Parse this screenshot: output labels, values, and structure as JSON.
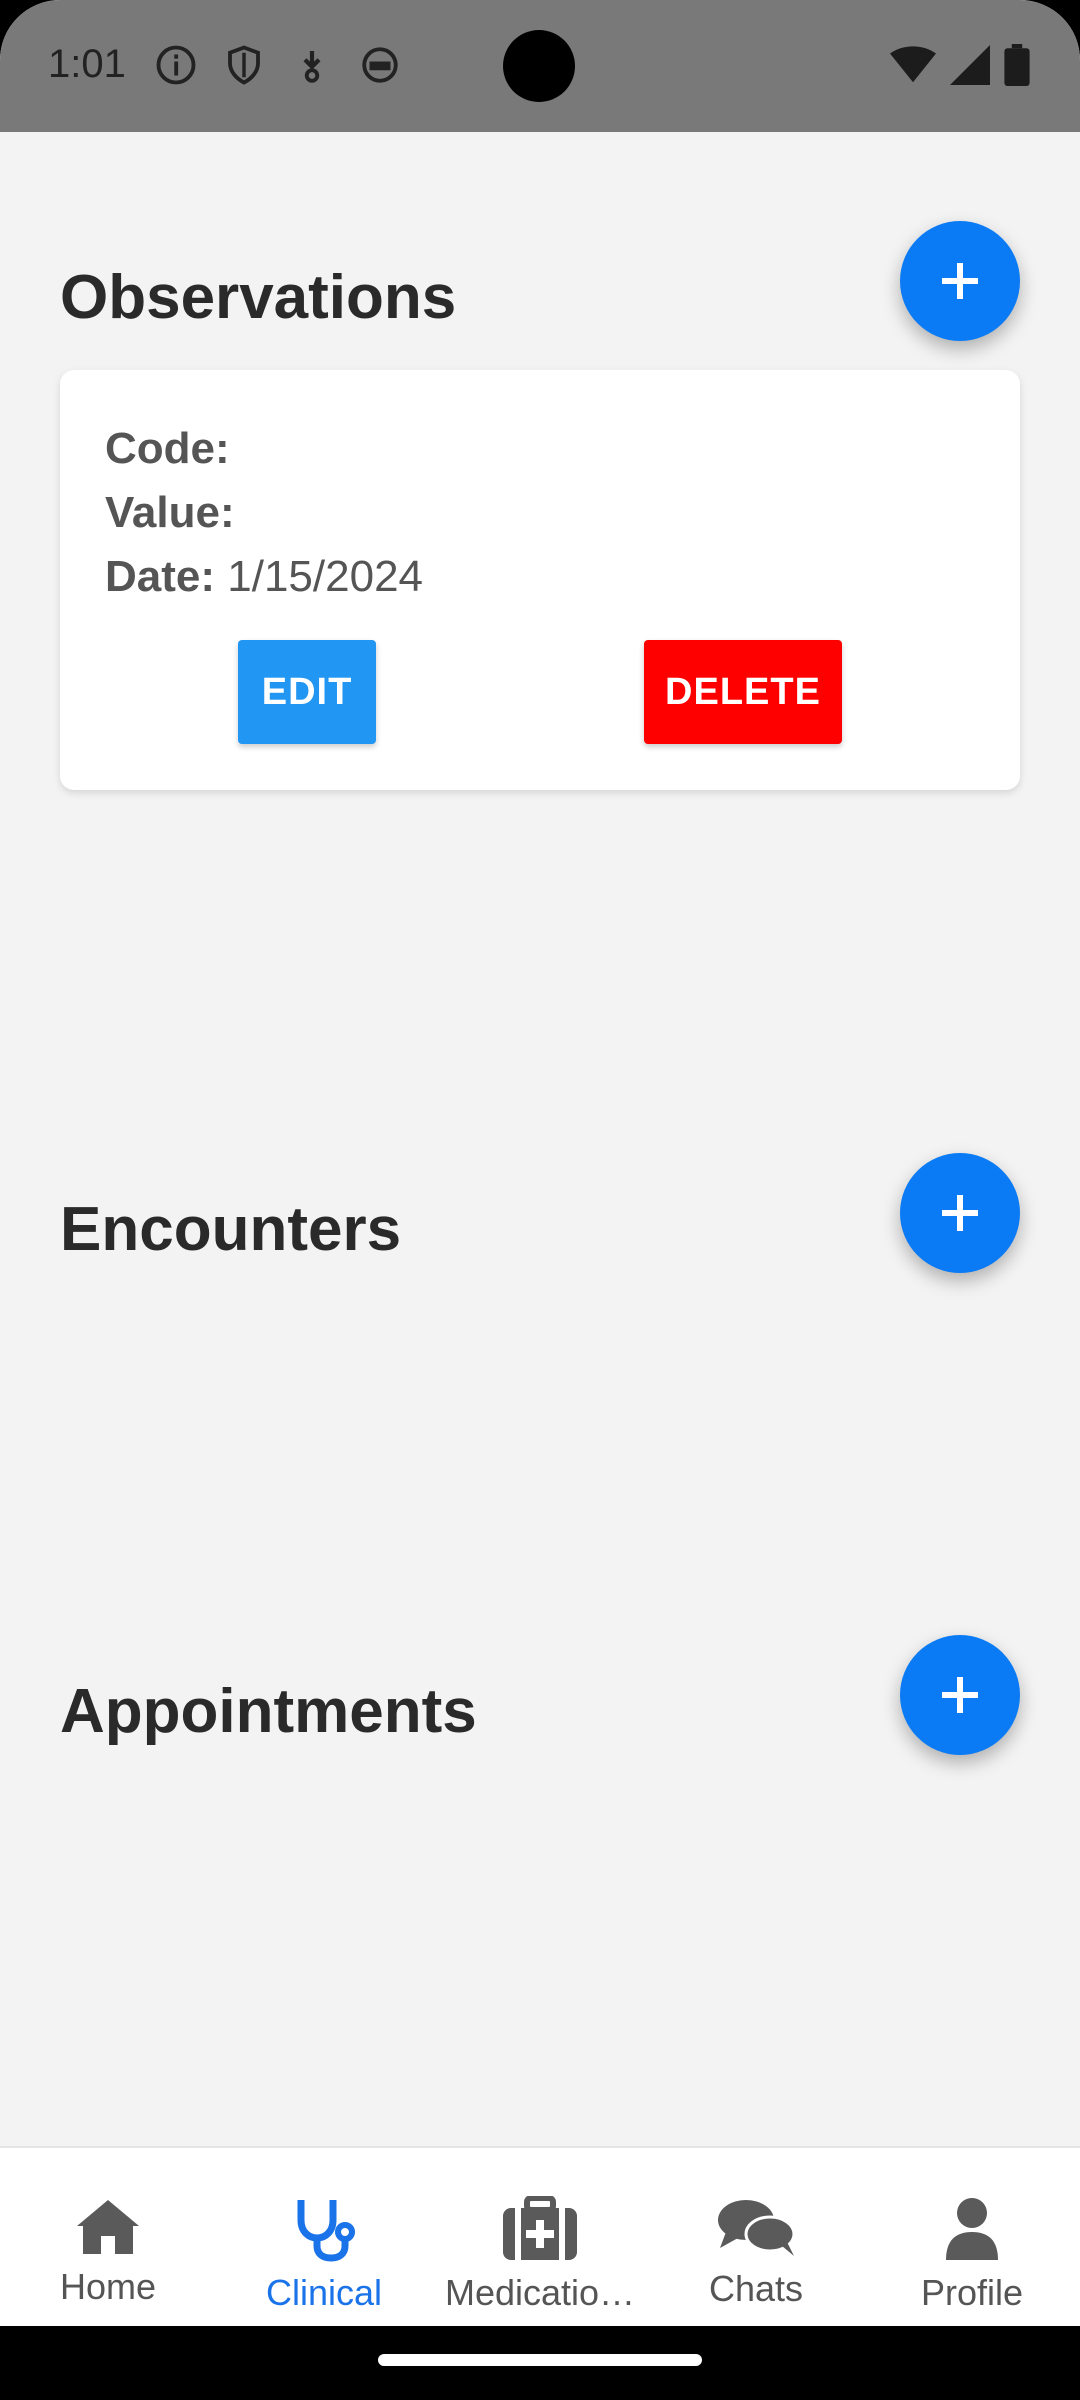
{
  "status_bar": {
    "time": "1:01"
  },
  "sections": {
    "observations": {
      "title": "Observations"
    },
    "encounters": {
      "title": "Encounters"
    },
    "appointments": {
      "title": "Appointments"
    }
  },
  "observation_card": {
    "code_label": "Code:",
    "code_value": "",
    "value_label": "Value:",
    "value_value": "",
    "date_label": "Date:",
    "date_value": "1/15/2024",
    "edit_label": "EDIT",
    "delete_label": "DELETE"
  },
  "tabs": [
    {
      "label": "Home",
      "icon": "home-icon"
    },
    {
      "label": "Clinical",
      "icon": "stethoscope-icon",
      "active": true
    },
    {
      "label": "Medicatio…",
      "icon": "medkit-icon"
    },
    {
      "label": "Chats",
      "icon": "chats-icon"
    },
    {
      "label": "Profile",
      "icon": "person-icon"
    }
  ],
  "colors": {
    "accent": "#0b7bf5",
    "edit": "#2196f3",
    "delete": "#ff0000",
    "active_tab": "#1a73e8"
  }
}
